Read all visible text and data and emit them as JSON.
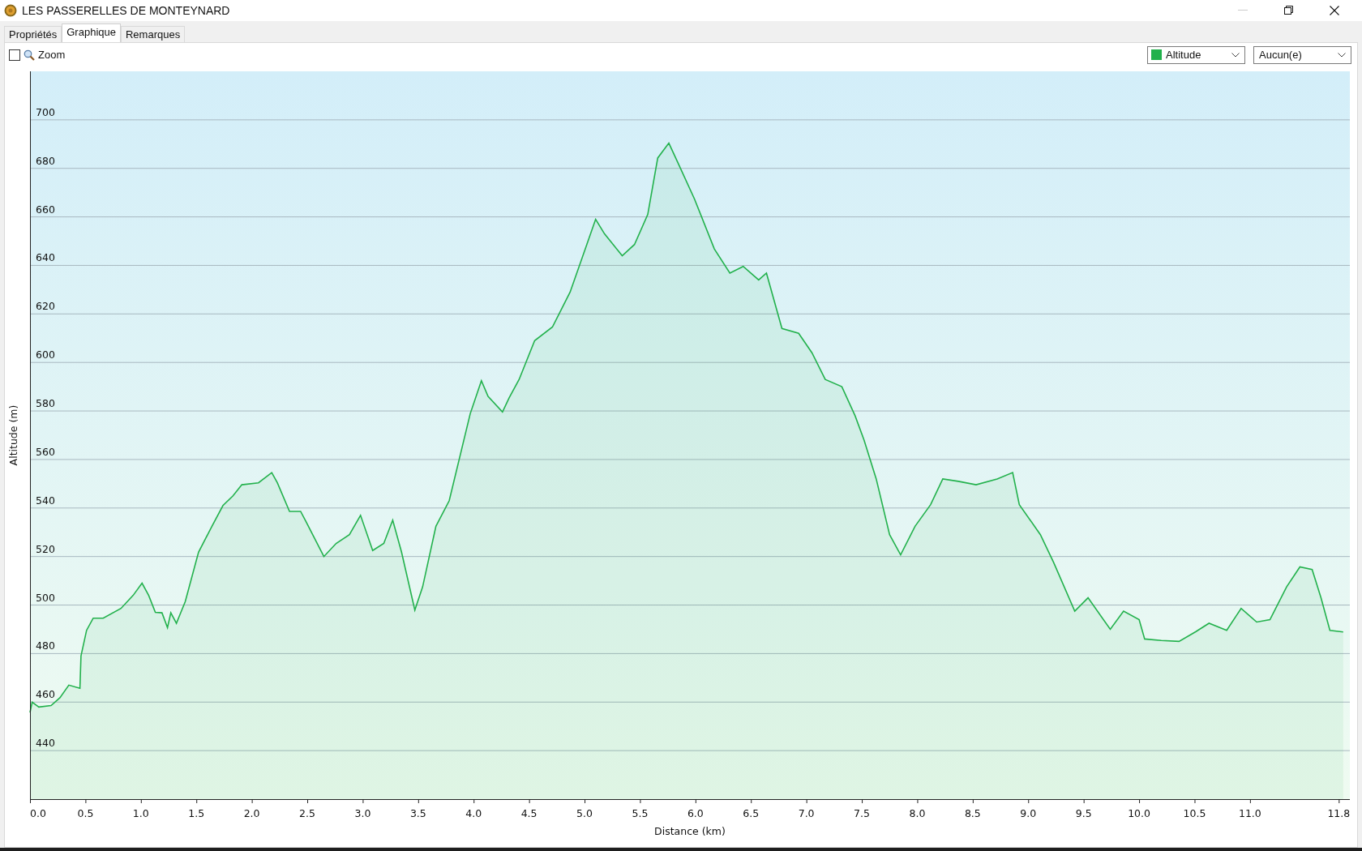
{
  "window": {
    "title": "LES PASSERELLES DE MONTEYNARD"
  },
  "tabs": [
    {
      "label": "Propriétés",
      "selected": false
    },
    {
      "label": "Graphique",
      "selected": true
    },
    {
      "label": "Remarques",
      "selected": false
    }
  ],
  "toolbar": {
    "zoom": {
      "label": "Zoom",
      "checked": false
    },
    "second_select": {
      "value": "Aucun(e)"
    }
  },
  "chart": {
    "chart_data": {
      "type": "area",
      "grid": true,
      "xlabel": "Distance (km)",
      "ylabel": "Altitude (m)",
      "xlim": [
        0,
        11.9
      ],
      "ylim": [
        420,
        720
      ],
      "xticks": [
        {
          "value": 0,
          "label": "0.0"
        },
        {
          "value": 0.5,
          "label": "0.5"
        },
        {
          "value": 1,
          "label": "1.0"
        },
        {
          "value": 1.5,
          "label": "1.5"
        },
        {
          "value": 2,
          "label": "2.0"
        },
        {
          "value": 2.5,
          "label": "2.5"
        },
        {
          "value": 3,
          "label": "3.0"
        },
        {
          "value": 3.5,
          "label": "3.5"
        },
        {
          "value": 4,
          "label": "4.0"
        },
        {
          "value": 4.5,
          "label": "4.5"
        },
        {
          "value": 5,
          "label": "5.0"
        },
        {
          "value": 5.5,
          "label": "5.5"
        },
        {
          "value": 6,
          "label": "6.0"
        },
        {
          "value": 6.5,
          "label": "6.5"
        },
        {
          "value": 7,
          "label": "7.0"
        },
        {
          "value": 7.5,
          "label": "7.5"
        },
        {
          "value": 8,
          "label": "8.0"
        },
        {
          "value": 8.5,
          "label": "8.5"
        },
        {
          "value": 9,
          "label": "9.0"
        },
        {
          "value": 9.5,
          "label": "9.5"
        },
        {
          "value": 10,
          "label": "10.0"
        },
        {
          "value": 10.5,
          "label": "10.5"
        },
        {
          "value": 11,
          "label": "11.0"
        },
        {
          "value": 11.8,
          "label": "11.8"
        }
      ],
      "yticks": [
        440,
        460,
        480,
        500,
        520,
        540,
        560,
        580,
        600,
        620,
        640,
        660,
        680,
        700
      ],
      "x": [
        0,
        0.02,
        0.08,
        0.19,
        0.27,
        0.35,
        0.45,
        0.46,
        0.51,
        0.57,
        0.66,
        0.82,
        0.93,
        1.01,
        1.07,
        1.13,
        1.19,
        1.24,
        1.27,
        1.32,
        1.4,
        1.52,
        1.64,
        1.74,
        1.83,
        1.91,
        2.06,
        2.18,
        2.23,
        2.34,
        2.44,
        2.49,
        2.65,
        2.76,
        2.88,
        2.98,
        3.09,
        3.19,
        3.27,
        3.35,
        3.47,
        3.54,
        3.66,
        3.78,
        3.97,
        4.07,
        4.13,
        4.26,
        4.32,
        4.41,
        4.55,
        4.71,
        4.87,
        5.02,
        5.1,
        5.18,
        5.34,
        5.45,
        5.57,
        5.66,
        5.76,
        5.84,
        5.99,
        6.17,
        6.31,
        6.43,
        6.57,
        6.64,
        6.78,
        6.93,
        7.05,
        7.17,
        7.32,
        7.44,
        7.52,
        7.63,
        7.75,
        7.85,
        7.98,
        8.12,
        8.23,
        8.37,
        8.53,
        8.72,
        8.86,
        8.92,
        9.11,
        9.23,
        9.42,
        9.54,
        9.74,
        9.86,
        10,
        10.05,
        10.2,
        10.36,
        10.51,
        10.63,
        10.79,
        10.92,
        11.06,
        11.18,
        11.33,
        11.45,
        11.56,
        11.64,
        11.72,
        11.84
      ],
      "series": [
        {
          "name": "Altitude",
          "color": "#22b14c",
          "values": [
            455.7,
            460,
            458,
            458.6,
            461.8,
            467,
            465.7,
            479,
            489.6,
            494.6,
            494.6,
            498.6,
            504,
            509,
            504,
            497,
            496.8,
            490.7,
            496.8,
            492.5,
            501.4,
            521.8,
            532.5,
            541,
            545,
            549.6,
            550.4,
            554.6,
            550.4,
            538.6,
            538.6,
            534.3,
            520,
            525.4,
            529,
            537,
            522.5,
            525.4,
            535,
            521.8,
            497.9,
            507.5,
            532.5,
            543,
            579,
            592.5,
            586,
            579.6,
            585.4,
            593,
            609,
            614.6,
            629,
            648.6,
            659,
            653,
            644,
            648.6,
            661,
            684.3,
            690.4,
            682.5,
            667.5,
            646.8,
            636.8,
            639.6,
            634,
            636.8,
            614,
            612,
            604,
            593,
            590,
            578,
            568,
            552,
            529,
            520.7,
            532.5,
            541.4,
            552,
            551,
            549.6,
            552,
            554.6,
            541.4,
            529,
            517.5,
            497.5,
            503,
            490,
            497.5,
            494,
            486,
            485.4,
            485,
            489,
            492.5,
            489.6,
            498.6,
            493,
            494,
            507.5,
            515.7,
            514.6,
            503,
            489.6,
            488.9
          ]
        }
      ]
    }
  }
}
